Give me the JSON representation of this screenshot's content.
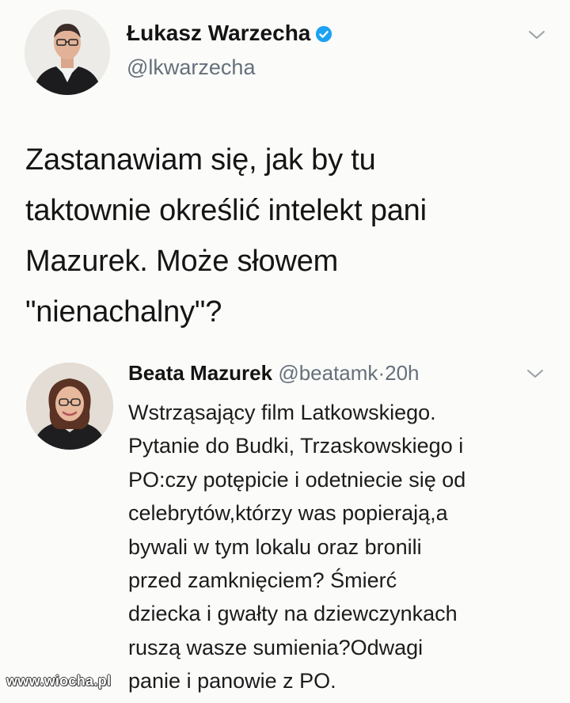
{
  "tweet": {
    "author_name": "Łukasz Warzecha",
    "author_handle": "@lkwarzecha",
    "verified_icon": "verified-badge-icon",
    "menu_icon": "chevron-down-icon",
    "text_lines": [
      "Zastanawiam się, jak by tu",
      "taktownie określić intelekt pani",
      "Mazurek. Może słowem",
      "\"nienachalny\"?"
    ]
  },
  "quoted": {
    "author_name": "Beata Mazurek",
    "author_handle": "@beatamk",
    "separator": "·",
    "time": "20h",
    "menu_icon": "chevron-down-icon",
    "text_lines": [
      "Wstrząsający film Latkowskiego.",
      "Pytanie do Budki, Trzaskowskiego i",
      "PO:czy potępicie i odetniecie się od",
      "celebrytów,którzy was popierają,a",
      "bywali w tym lokalu oraz bronili",
      "przed zamknięciem? Śmierć",
      "dziecka i gwałty na dziewczynkach",
      "ruszą wasze sumienia?Odwagi",
      "panie i panowie z PO."
    ]
  },
  "watermark": "www.wiocha.pl",
  "colors": {
    "background": "#fbfbfa",
    "verified": "#1da1f2",
    "handle": "#66707a",
    "text": "#151515"
  }
}
